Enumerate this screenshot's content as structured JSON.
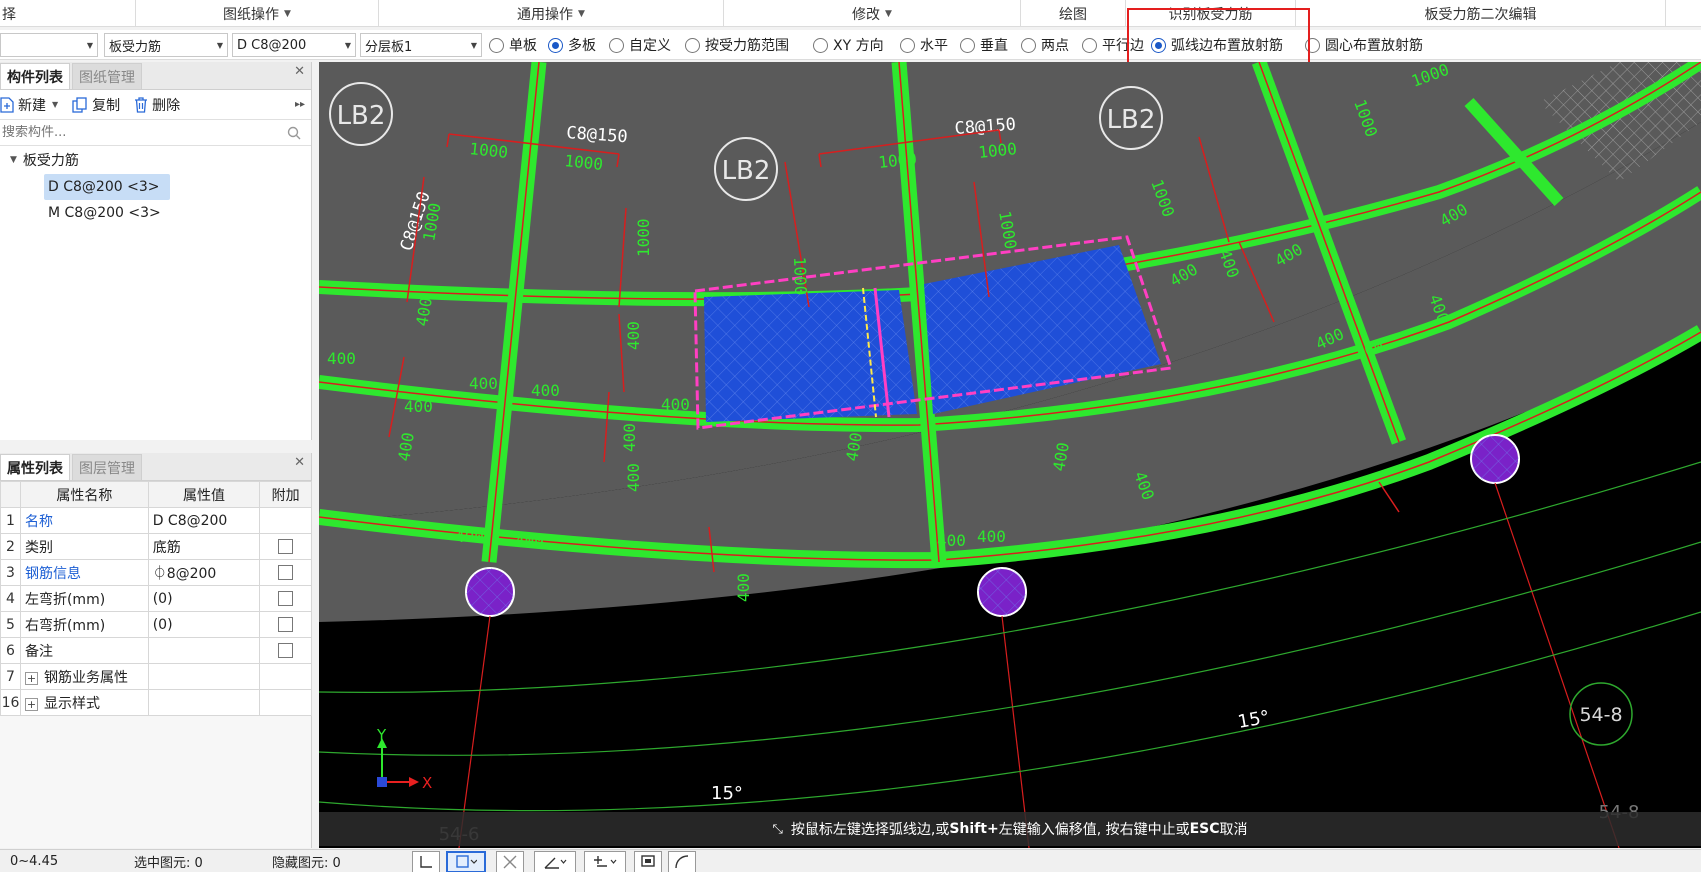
{
  "ribbon": {
    "groups": [
      {
        "label": "择",
        "dropdown": false
      },
      {
        "label": "图纸操作",
        "dropdown": true
      },
      {
        "label": "通用操作",
        "dropdown": true
      },
      {
        "label": "修改",
        "dropdown": true
      },
      {
        "label": "绘图",
        "dropdown": false
      },
      {
        "label": "识别板受力筋",
        "dropdown": false
      },
      {
        "label": "板受力筋二次编辑",
        "dropdown": false
      }
    ]
  },
  "toolbar": {
    "combos": [
      {
        "value": ""
      },
      {
        "value": "板受力筋"
      },
      {
        "value": "D C8@200"
      },
      {
        "value": "分层板1"
      }
    ],
    "radios": [
      {
        "label": "单板",
        "checked": false
      },
      {
        "label": "多板",
        "checked": true
      },
      {
        "label": "自定义",
        "checked": false
      },
      {
        "label": "按受力筋范围",
        "checked": false
      },
      {
        "label": "XY 方向",
        "checked": false
      },
      {
        "label": "水平",
        "checked": false
      },
      {
        "label": "垂直",
        "checked": false
      },
      {
        "label": "两点",
        "checked": false
      },
      {
        "label": "平行边",
        "checked": false
      },
      {
        "label": "弧线边布置放射筋",
        "checked": true
      },
      {
        "label": "圆心布置放射筋",
        "checked": false
      }
    ],
    "highlight_color": "#e41e1e"
  },
  "component_panel": {
    "tabs": [
      "构件列表",
      "图纸管理"
    ],
    "buttons": {
      "new": "新建",
      "copy": "复制",
      "delete": "删除"
    },
    "search_placeholder": "搜索构件...",
    "tree_root": "板受力筋",
    "items": [
      {
        "label": "D C8@200 <3>",
        "selected": true
      },
      {
        "label": "M C8@200 <3>",
        "selected": false
      }
    ]
  },
  "property_panel": {
    "tabs": [
      "属性列表",
      "图层管理"
    ],
    "headers": {
      "name": "属性名称",
      "value": "属性值",
      "extra": "附加"
    },
    "rows": [
      {
        "no": "1",
        "name": "名称",
        "value": "D C8@200",
        "blue": true,
        "check": false,
        "expand": false
      },
      {
        "no": "2",
        "name": "类别",
        "value": "底筋",
        "blue": false,
        "check": true,
        "expand": false
      },
      {
        "no": "3",
        "name": "钢筋信息",
        "value": "⏀8@200",
        "blue": true,
        "check": true,
        "expand": false
      },
      {
        "no": "4",
        "name": "左弯折(mm)",
        "value": "(0)",
        "blue": false,
        "check": true,
        "expand": false
      },
      {
        "no": "5",
        "name": "右弯折(mm)",
        "value": "(0)",
        "blue": false,
        "check": true,
        "expand": false
      },
      {
        "no": "6",
        "name": "备注",
        "value": "",
        "blue": false,
        "check": true,
        "expand": false
      },
      {
        "no": "7",
        "name": "钢筋业务属性",
        "value": "",
        "blue": false,
        "check": false,
        "expand": true
      },
      {
        "no": "16",
        "name": "显示样式",
        "value": "",
        "blue": false,
        "check": false,
        "expand": true
      }
    ]
  },
  "canvas": {
    "slab_labels": [
      "LB2",
      "LB2",
      "LB2"
    ],
    "rebar_labels": [
      "C8@150",
      "C8@150",
      "C8@150"
    ],
    "dimension_labels": [
      "1000",
      "400"
    ],
    "angle_labels": [
      "15°",
      "15°"
    ],
    "axis_labels": [
      "54-6",
      "54-8",
      "54-8"
    ],
    "ucs": {
      "x": "X",
      "y": "Y"
    },
    "colors": {
      "beam": "#2ee82e",
      "slab": "#5c5c5c",
      "selected_slab": "#1f4fd8",
      "column": "#7a22c8",
      "dim": "#d81e1e"
    }
  },
  "hint": {
    "text_a": "按鼠标左键选择弧线边,或 ",
    "key_shift": "Shift+",
    "text_b": " 左键输入偏移值, 按右键中止或 ",
    "key_esc": "ESC",
    "text_c": " 取消"
  },
  "status": {
    "elevation": "0~4.45",
    "selected": "选中图元: 0",
    "hidden": "隐藏图元: 0"
  }
}
